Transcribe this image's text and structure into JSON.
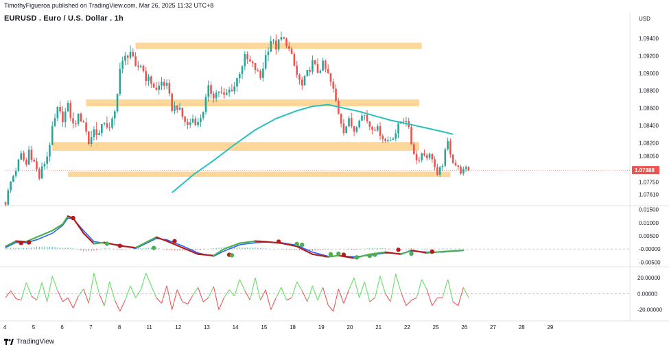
{
  "header": {
    "published_by": "TimothyFigueroa published on TradingView.com, Mar 26, 2025 11:32 UTC+8",
    "title": "EURUSD . Euro / U.S. Dollar . 1h"
  },
  "footer": {
    "brand": "TradingView"
  },
  "colors": {
    "up": "#26a69a",
    "down": "#ef5350",
    "zone": "#fdd79a",
    "ma": "#26c0c0",
    "macd_green": "#4caf50",
    "macd_blue": "#2962ff",
    "macd_red": "#b71c1c",
    "osc_green": "#66dd66",
    "osc_red": "#ee5555",
    "price_label": "#ef5350"
  },
  "chart_data": [
    {
      "type": "candlestick",
      "title": "EURUSD . Euro / U.S. Dollar . 1h",
      "currency": "USD",
      "current_price": "1.07888",
      "y_ticks": [
        "1.09400",
        "1.09200",
        "1.09000",
        "1.08800",
        "1.08600",
        "1.08400",
        "1.08200",
        "1.08050",
        "1.07750",
        "1.07610"
      ],
      "ylim": [
        1.0748,
        1.0962
      ],
      "x_ticks": [
        "4",
        "5",
        "6",
        "7",
        "8",
        "11",
        "12",
        "13",
        "14",
        "15",
        "18",
        "19",
        "20",
        "21",
        "22",
        "25",
        "26",
        "27",
        "28",
        "29"
      ],
      "close_path": [
        [
          0,
          1.0752
        ],
        [
          2,
          1.0775
        ],
        [
          4,
          1.079
        ],
        [
          6,
          1.0806
        ],
        [
          8,
          1.0795
        ],
        [
          9,
          1.0812
        ],
        [
          11,
          1.0798
        ],
        [
          13,
          1.078
        ],
        [
          14,
          1.079
        ],
        [
          16,
          1.0805
        ],
        [
          18,
          1.0835
        ],
        [
          20,
          1.0858
        ],
        [
          22,
          1.0848
        ],
        [
          24,
          1.0862
        ],
        [
          26,
          1.084
        ],
        [
          28,
          1.085
        ],
        [
          30,
          1.0845
        ],
        [
          32,
          1.082
        ],
        [
          34,
          1.0835
        ],
        [
          36,
          1.083
        ],
        [
          38,
          1.0845
        ],
        [
          40,
          1.0835
        ],
        [
          42,
          1.0855
        ],
        [
          44,
          1.0905
        ],
        [
          46,
          1.0918
        ],
        [
          48,
          1.0925
        ],
        [
          50,
          1.0905
        ],
        [
          52,
          1.091
        ],
        [
          54,
          1.0895
        ],
        [
          56,
          1.089
        ],
        [
          58,
          1.088
        ],
        [
          60,
          1.089
        ],
        [
          62,
          1.0885
        ],
        [
          64,
          1.086
        ],
        [
          66,
          1.0862
        ],
        [
          68,
          1.085
        ],
        [
          70,
          1.084
        ],
        [
          72,
          1.0848
        ],
        [
          74,
          1.0842
        ],
        [
          76,
          1.0858
        ],
        [
          78,
          1.0882
        ],
        [
          80,
          1.0875
        ],
        [
          82,
          1.088
        ],
        [
          84,
          1.0873
        ],
        [
          86,
          1.088
        ],
        [
          88,
          1.0885
        ],
        [
          90,
          1.0902
        ],
        [
          92,
          1.0918
        ],
        [
          94,
          1.0912
        ],
        [
          96,
          1.0905
        ],
        [
          98,
          1.0895
        ],
        [
          100,
          1.092
        ],
        [
          102,
          1.0938
        ],
        [
          104,
          1.093
        ],
        [
          106,
          1.094
        ],
        [
          108,
          1.0935
        ],
        [
          110,
          1.0918
        ],
        [
          112,
          1.0898
        ],
        [
          114,
          1.0885
        ],
        [
          116,
          1.09
        ],
        [
          118,
          1.0912
        ],
        [
          120,
          1.0902
        ],
        [
          122,
          1.091
        ],
        [
          124,
          1.0898
        ],
        [
          126,
          1.088
        ],
        [
          128,
          1.0855
        ],
        [
          130,
          1.0835
        ],
        [
          132,
          1.0845
        ],
        [
          134,
          1.0835
        ],
        [
          136,
          1.085
        ],
        [
          138,
          1.0852
        ],
        [
          140,
          1.084
        ],
        [
          142,
          1.0838
        ],
        [
          144,
          1.0832
        ],
        [
          146,
          1.0822
        ],
        [
          148,
          1.0825
        ],
        [
          150,
          1.0832
        ],
        [
          152,
          1.0845
        ],
        [
          154,
          1.0848
        ],
        [
          156,
          1.082
        ],
        [
          158,
          1.08
        ],
        [
          160,
          1.0808
        ],
        [
          162,
          1.0806
        ],
        [
          164,
          1.0804
        ],
        [
          166,
          1.078
        ],
        [
          168,
          1.0797
        ],
        [
          170,
          1.082
        ],
        [
          172,
          1.08
        ],
        [
          174,
          1.079
        ],
        [
          176,
          1.0787
        ],
        [
          178,
          1.079
        ]
      ],
      "volatility_path": [
        [
          0,
          7
        ],
        [
          18,
          15
        ],
        [
          42,
          20
        ],
        [
          64,
          12
        ],
        [
          100,
          16
        ],
        [
          126,
          14
        ],
        [
          156,
          12
        ],
        [
          178,
          8
        ]
      ],
      "ma": {
        "name": "",
        "points": [
          [
            64,
            1.0763
          ],
          [
            72,
            1.0783
          ],
          [
            80,
            1.08
          ],
          [
            88,
            1.0818
          ],
          [
            96,
            1.0835
          ],
          [
            104,
            1.0848
          ],
          [
            112,
            1.0857
          ],
          [
            118,
            1.0862
          ],
          [
            124,
            1.0864
          ],
          [
            130,
            1.086
          ],
          [
            136,
            1.0856
          ],
          [
            142,
            1.0851
          ],
          [
            148,
            1.0846
          ],
          [
            156,
            1.0841
          ],
          [
            162,
            1.0837
          ],
          [
            168,
            1.0833
          ],
          [
            172,
            1.083
          ]
        ]
      },
      "zones": [
        {
          "label": "",
          "from": 1.0928,
          "to": 1.0935,
          "start": 50,
          "end": 160
        },
        {
          "label": "",
          "from": 1.0862,
          "to": 1.087,
          "start": 31,
          "end": 159
        },
        {
          "label": "",
          "from": 1.0811,
          "to": 1.0821,
          "start": 18,
          "end": 159
        },
        {
          "label": "",
          "from": 1.0781,
          "to": 1.0787,
          "start": 24,
          "end": 171
        }
      ]
    },
    {
      "type": "line",
      "name": "",
      "y_ticks": [
        "0.01500",
        "0.01000",
        "0.00500",
        "-0.00000",
        "-0.00500"
      ],
      "ylim": [
        -0.0065,
        0.0165
      ],
      "series": [
        {
          "name": "",
          "points": [
            [
              0,
              0.001
            ],
            [
              4,
              0.003
            ],
            [
              8,
              0.0028
            ],
            [
              12,
              0.0045
            ],
            [
              18,
              0.007
            ],
            [
              22,
              0.0095
            ],
            [
              24,
              0.0125
            ],
            [
              26,
              0.0118
            ],
            [
              30,
              0.006
            ],
            [
              34,
              0.002
            ],
            [
              38,
              0.0025
            ],
            [
              44,
              0.0012
            ],
            [
              50,
              0.0005
            ],
            [
              58,
              0.0045
            ],
            [
              62,
              0.003
            ],
            [
              68,
              0.0005
            ],
            [
              74,
              -0.002
            ],
            [
              80,
              -0.0025
            ],
            [
              84,
              0.0
            ],
            [
              90,
              0.0022
            ],
            [
              96,
              0.003
            ],
            [
              100,
              0.0028
            ],
            [
              106,
              0.0022
            ],
            [
              112,
              0.001
            ],
            [
              118,
              -0.002
            ],
            [
              124,
              -0.003
            ],
            [
              128,
              -0.0025
            ],
            [
              134,
              -0.0035
            ],
            [
              140,
              -0.002
            ],
            [
              146,
              -0.0012
            ],
            [
              152,
              -0.002
            ],
            [
              156,
              -0.0005
            ],
            [
              162,
              -0.0015
            ],
            [
              168,
              -0.001
            ],
            [
              176,
              -0.0005
            ]
          ]
        },
        {
          "name": "",
          "points": [
            [
              0,
              0.0005
            ],
            [
              4,
              0.0025
            ],
            [
              8,
              0.0024
            ],
            [
              12,
              0.0035
            ],
            [
              18,
              0.006
            ],
            [
              22,
              0.009
            ],
            [
              24,
              0.0118
            ],
            [
              26,
              0.0115
            ],
            [
              30,
              0.007
            ],
            [
              34,
              0.0028
            ],
            [
              38,
              0.0022
            ],
            [
              44,
              0.0015
            ],
            [
              50,
              0.0002
            ],
            [
              58,
              0.004
            ],
            [
              62,
              0.0035
            ],
            [
              68,
              0.0012
            ],
            [
              74,
              -0.0015
            ],
            [
              80,
              -0.0028
            ],
            [
              84,
              -0.0008
            ],
            [
              90,
              0.0016
            ],
            [
              96,
              0.0024
            ],
            [
              100,
              0.0026
            ],
            [
              106,
              0.0024
            ],
            [
              112,
              0.0014
            ],
            [
              118,
              -0.0012
            ],
            [
              124,
              -0.0028
            ],
            [
              128,
              -0.0026
            ],
            [
              134,
              -0.003
            ],
            [
              140,
              -0.0024
            ],
            [
              146,
              -0.0015
            ],
            [
              152,
              -0.0018
            ],
            [
              156,
              -0.0008
            ],
            [
              162,
              -0.0012
            ],
            [
              168,
              -0.0012
            ],
            [
              176,
              -0.0006
            ]
          ]
        }
      ],
      "markers": [
        {
          "at": 6,
          "value": 0.0023,
          "color": "#b71c1c"
        },
        {
          "at": 9,
          "value": 0.0025,
          "color": "#b71c1c"
        },
        {
          "at": 26,
          "value": 0.0118,
          "color": "#b71c1c"
        },
        {
          "at": 39,
          "value": 0.002,
          "color": "#4caf50"
        },
        {
          "at": 44,
          "value": 0.0012,
          "color": "#b71c1c"
        },
        {
          "at": 57,
          "value": 0.0004,
          "color": "#4caf50"
        },
        {
          "at": 65,
          "value": 0.003,
          "color": "#b71c1c"
        },
        {
          "at": 86,
          "value": -0.0022,
          "color": "#b71c1c"
        },
        {
          "at": 87,
          "value": -0.0024,
          "color": "#4caf50"
        },
        {
          "at": 105,
          "value": 0.0028,
          "color": "#b71c1c"
        },
        {
          "at": 112,
          "value": 0.0019,
          "color": "#4caf50"
        },
        {
          "at": 114,
          "value": 0.0016,
          "color": "#4caf50"
        },
        {
          "at": 125,
          "value": -0.002,
          "color": "#4caf50"
        },
        {
          "at": 128,
          "value": -0.0018,
          "color": "#4caf50"
        },
        {
          "at": 130,
          "value": -0.0022,
          "color": "#b71c1c"
        },
        {
          "at": 135,
          "value": -0.0032,
          "color": "#4caf50"
        },
        {
          "at": 140,
          "value": -0.0026,
          "color": "#4caf50"
        },
        {
          "at": 142,
          "value": -0.0022,
          "color": "#4caf50"
        },
        {
          "at": 151,
          "value": -0.0003,
          "color": "#b71c1c"
        },
        {
          "at": 156,
          "value": -0.0018,
          "color": "#4caf50"
        },
        {
          "at": 164,
          "value": -0.001,
          "color": "#b71c1c"
        }
      ]
    },
    {
      "type": "line",
      "name": "",
      "y_ticks": [
        "20.00000",
        "0.00000",
        "-20.00000"
      ],
      "ylim": [
        -34,
        33
      ],
      "points": [
        [
          0,
          -5
        ],
        [
          2,
          4
        ],
        [
          4,
          -6
        ],
        [
          6,
          -8
        ],
        [
          8,
          14
        ],
        [
          10,
          -3
        ],
        [
          12,
          -8
        ],
        [
          14,
          14
        ],
        [
          16,
          -10
        ],
        [
          18,
          22
        ],
        [
          20,
          4
        ],
        [
          22,
          -10
        ],
        [
          24,
          -5
        ],
        [
          26,
          -18
        ],
        [
          28,
          -3
        ],
        [
          30,
          6
        ],
        [
          32,
          -12
        ],
        [
          34,
          26
        ],
        [
          36,
          0
        ],
        [
          38,
          -15
        ],
        [
          40,
          15
        ],
        [
          42,
          -8
        ],
        [
          44,
          -22
        ],
        [
          46,
          -8
        ],
        [
          48,
          10
        ],
        [
          50,
          -5
        ],
        [
          52,
          5
        ],
        [
          54,
          26
        ],
        [
          56,
          10
        ],
        [
          58,
          -5
        ],
        [
          60,
          -12
        ],
        [
          62,
          10
        ],
        [
          64,
          -20
        ],
        [
          66,
          5
        ],
        [
          68,
          -10
        ],
        [
          70,
          -13
        ],
        [
          72,
          -2
        ],
        [
          74,
          8
        ],
        [
          76,
          -10
        ],
        [
          78,
          -5
        ],
        [
          80,
          9
        ],
        [
          82,
          -20
        ],
        [
          84,
          -5
        ],
        [
          86,
          5
        ],
        [
          88,
          -3
        ],
        [
          90,
          18
        ],
        [
          92,
          4
        ],
        [
          94,
          -8
        ],
        [
          96,
          20
        ],
        [
          98,
          -8
        ],
        [
          100,
          5
        ],
        [
          102,
          -20
        ],
        [
          104,
          -5
        ],
        [
          106,
          8
        ],
        [
          108,
          -8
        ],
        [
          110,
          -5
        ],
        [
          112,
          15
        ],
        [
          114,
          4
        ],
        [
          116,
          -10
        ],
        [
          118,
          10
        ],
        [
          120,
          -8
        ],
        [
          122,
          8
        ],
        [
          124,
          -14
        ],
        [
          126,
          -22
        ],
        [
          128,
          6
        ],
        [
          130,
          -12
        ],
        [
          132,
          5
        ],
        [
          134,
          20
        ],
        [
          136,
          -5
        ],
        [
          138,
          15
        ],
        [
          140,
          -10
        ],
        [
          142,
          -5
        ],
        [
          144,
          22
        ],
        [
          146,
          0
        ],
        [
          148,
          -10
        ],
        [
          150,
          25
        ],
        [
          152,
          2
        ],
        [
          154,
          -15
        ],
        [
          156,
          -8
        ],
        [
          158,
          -5
        ],
        [
          160,
          18
        ],
        [
          162,
          5
        ],
        [
          164,
          -15
        ],
        [
          166,
          -5
        ],
        [
          168,
          -5
        ],
        [
          170,
          18
        ],
        [
          172,
          -10
        ],
        [
          174,
          -15
        ],
        [
          176,
          8
        ],
        [
          178,
          -5
        ]
      ]
    }
  ]
}
